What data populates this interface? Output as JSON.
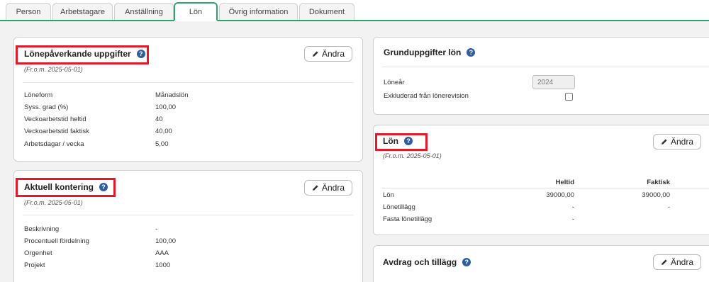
{
  "tabs": [
    "Person",
    "Arbetstagare",
    "Anställning",
    "Lön",
    "Övrig information",
    "Dokument"
  ],
  "edit_label": "Ändra",
  "help_glyph": "?",
  "colors": {
    "accent": "#2ea36b",
    "highlight": "#e21b2a",
    "help": "#2f5f9e"
  },
  "lonepaverkande": {
    "title": "Lönepåverkande uppgifter",
    "date": "(Fr.o.m. 2025-05-01)",
    "rows": [
      {
        "label": "Löneform",
        "value": "Månadslön"
      },
      {
        "label": "Syss. grad (%)",
        "value": "100,00"
      },
      {
        "label": "Veckoarbetstid heltid",
        "value": "40"
      },
      {
        "label": "Veckoarbetstid faktisk",
        "value": "40,00"
      },
      {
        "label": "Arbetsdagar / vecka",
        "value": "5,00"
      }
    ]
  },
  "kontering": {
    "title": "Aktuell kontering",
    "date": "(Fr.o.m. 2025-05-01)",
    "rows": [
      {
        "label": "Beskrivning",
        "value": "-"
      },
      {
        "label": "Procentuell fördelning",
        "value": "100,00"
      },
      {
        "label": "Orgenhet",
        "value": "AAA"
      },
      {
        "label": "Projekt",
        "value": "1000"
      }
    ]
  },
  "grunduppgifter": {
    "title": "Grunduppgifter lön",
    "lonear_label": "Löneår",
    "lonear_value": "2024",
    "exkluderad_label": "Exkluderad från lönerevision",
    "exkluderad_checked": false
  },
  "lon": {
    "title": "Lön",
    "date": "(Fr.o.m. 2025-05-01)",
    "col_heltid": "Heltid",
    "col_faktisk": "Faktisk",
    "rows": [
      {
        "label": "Lön",
        "heltid": "39000,00",
        "faktisk": "39000,00"
      },
      {
        "label": "Lönetillägg",
        "heltid": "-",
        "faktisk": "-"
      },
      {
        "label": "Fasta lönetillägg",
        "heltid": "-",
        "faktisk": ""
      }
    ]
  },
  "avdrag": {
    "title": "Avdrag och tillägg"
  }
}
